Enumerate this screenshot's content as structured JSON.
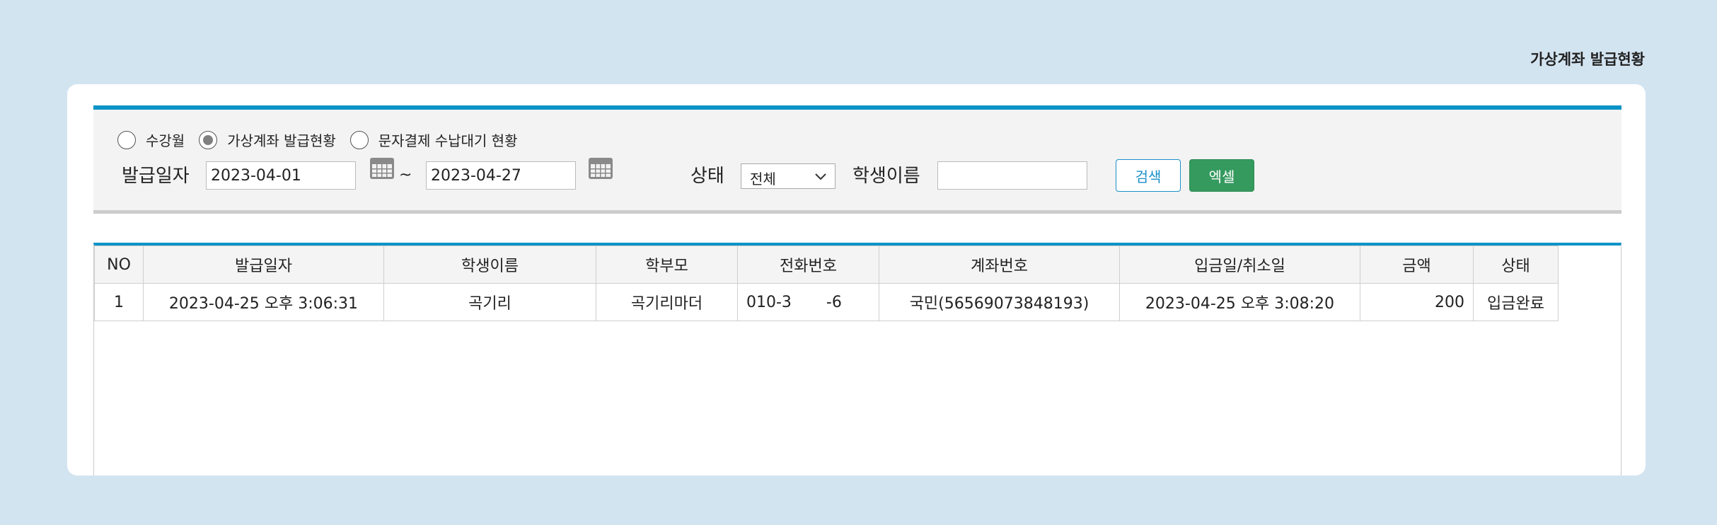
{
  "page": {
    "title": "가상계좌 발급현황"
  },
  "filter": {
    "radios": [
      {
        "label": "수강월",
        "checked": false
      },
      {
        "label": "가상계좌 발급현황",
        "checked": true
      },
      {
        "label": "문자결제 수납대기 현황",
        "checked": false
      }
    ],
    "date_label": "발급일자",
    "date_from": "2023-04-01",
    "date_to": "2023-04-27",
    "tilde": "~",
    "status_label": "상태",
    "status_value": "전체",
    "student_label": "학생이름",
    "student_value": "",
    "search_label": "검색",
    "excel_label": "엑셀"
  },
  "table": {
    "headers": [
      "NO",
      "발급일자",
      "학생이름",
      "학부모",
      "전화번호",
      "계좌번호",
      "입금일/취소일",
      "금액",
      "상태"
    ],
    "rows": [
      [
        "1",
        "2023-04-25 오후 3:06:31",
        "곡기리",
        "곡기리마더",
        "010-3       -6",
        "국민(56569073848193)",
        "2023-04-25 오후 3:08:20",
        "200",
        "입금완료"
      ]
    ]
  },
  "colors": {
    "accent": "#0a93c7",
    "excel": "#349a5e",
    "background": "#d3e4f1"
  }
}
